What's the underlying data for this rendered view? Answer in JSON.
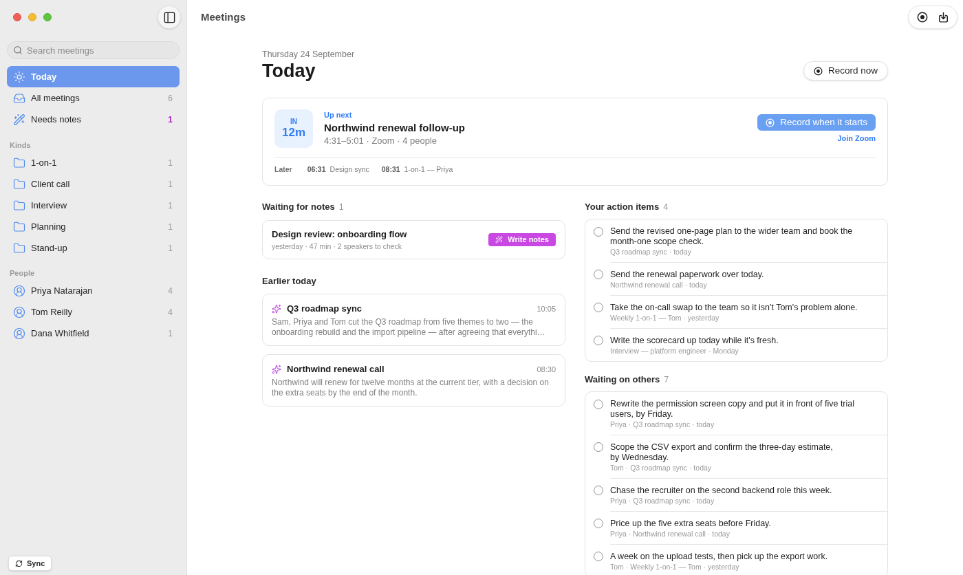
{
  "window": {
    "title": "Meetings"
  },
  "sidebar": {
    "search": {
      "placeholder": "Search meetings"
    },
    "nav": [
      {
        "label": "Today",
        "selected": true
      },
      {
        "label": "All meetings",
        "count": {
          "text": "6",
          "attention": false
        },
        "selected": false
      },
      {
        "label": "Needs notes",
        "count": {
          "text": "1",
          "attention": true
        },
        "selected": false
      }
    ],
    "sections": [
      {
        "title": "Kinds",
        "kind": "folder",
        "items": [
          {
            "label": "1-on-1",
            "count": "1",
            "selected": false
          },
          {
            "label": "Client call",
            "count": "1",
            "selected": false
          },
          {
            "label": "Interview",
            "count": "1",
            "selected": false
          },
          {
            "label": "Planning",
            "count": "1",
            "selected": false
          },
          {
            "label": "Stand-up",
            "count": "1",
            "selected": false
          }
        ]
      },
      {
        "title": "People",
        "kind": "person",
        "items": [
          {
            "label": "Priya Natarajan",
            "count": "4",
            "selected": false
          },
          {
            "label": "Tom Reilly",
            "count": "4",
            "selected": false
          },
          {
            "label": "Dana Whitfield",
            "count": "1",
            "selected": false
          }
        ]
      }
    ],
    "sync_button": "Sync"
  },
  "header": {
    "date": "Thursday 24 September",
    "title": "Today",
    "record_button": "Record now"
  },
  "up_next": {
    "label": "Up next",
    "countdown": {
      "prefix": "IN",
      "value": "12m"
    },
    "title": "Northwind renewal follow-up",
    "meta": "4:31–5:01 · Zoom · 4 people",
    "record_button": "Record when it starts",
    "join_link": "Join Zoom",
    "later_label": "Later",
    "later": [
      {
        "time": "06:31",
        "title": "Design sync"
      },
      {
        "time": "08:31",
        "title": "1-on-1 — Priya"
      }
    ]
  },
  "waiting_for_notes": {
    "title": "Waiting for notes",
    "count": "1",
    "items": [
      {
        "title": "Design review: onboarding flow",
        "meta": "yesterday · 47 min · 2 speakers to check",
        "button": "Write notes"
      }
    ]
  },
  "earlier_today": {
    "title": "Earlier today",
    "meetings": [
      {
        "title": "Q3 roadmap sync",
        "time": "10:05",
        "summary": "Sam, Priya and Tom cut the Q3 roadmap from five themes to two — the onboarding rebuild and the import pipeline — after agreeing that everythi…"
      },
      {
        "title": "Northwind renewal call",
        "time": "08:30",
        "summary": "Northwind will renew for twelve months at the current tier, with a decision on the extra seats by the end of the month."
      }
    ]
  },
  "action_items": {
    "title": "Your action items",
    "count": "4",
    "items": [
      {
        "text": "Send the revised one-page plan to the wider team and book the month-one scope check.",
        "meta": "Q3 roadmap sync · today",
        "checked": false
      },
      {
        "text": "Send the renewal paperwork over today.",
        "meta": "Northwind renewal call · today",
        "checked": false
      },
      {
        "text": "Take the on-call swap to the team so it isn't Tom's problem alone.",
        "meta": "Weekly 1-on-1 — Tom · yesterday",
        "checked": false
      },
      {
        "text": "Write the scorecard up today while it's fresh.",
        "meta": "Interview — platform engineer · Monday",
        "checked": false
      }
    ]
  },
  "waiting_on_others": {
    "title": "Waiting on others",
    "count": "7",
    "items": [
      {
        "text": "Rewrite the permission screen copy and put it in front of five trial users, by Friday.",
        "meta": "Priya · Q3 roadmap sync · today",
        "checked": false
      },
      {
        "text": "Scope the CSV export and confirm the three-day estimate, by Wednesday.",
        "meta": "Tom · Q3 roadmap sync · today",
        "checked": false
      },
      {
        "text": "Chase the recruiter on the second backend role this week.",
        "meta": "Priya · Q3 roadmap sync · today",
        "checked": false
      },
      {
        "text": "Price up the five extra seats before Friday.",
        "meta": "Priya · Northwind renewal call · today",
        "checked": false
      },
      {
        "text": "A week on the upload tests, then pick up the export work.",
        "meta": "Tom · Weekly 1-on-1 — Tom · yesterday",
        "checked": false
      }
    ]
  }
}
